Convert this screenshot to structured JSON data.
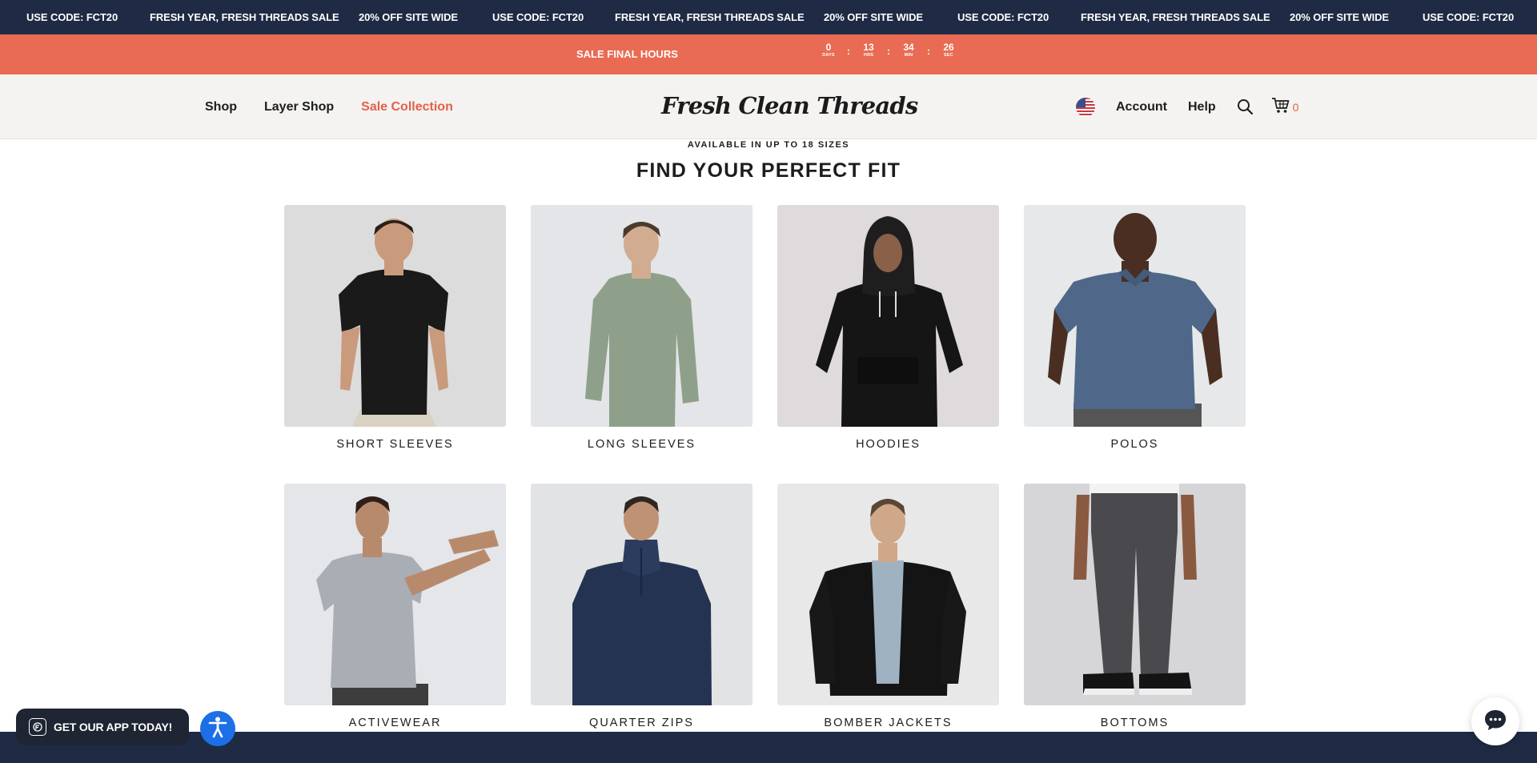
{
  "promo_marquee": {
    "items": [
      "USE CODE: FCT20",
      "FRESH YEAR, FRESH THREADS SALE",
      "20% OFF SITE WIDE",
      "USE CODE: FCT20",
      "FRESH YEAR, FRESH THREADS SALE",
      "20% OFF SITE WIDE",
      "USE CODE: FCT20",
      "FRESH YEAR, FRESH THREADS SALE",
      "20% OFF SITE WIDE",
      "USE CODE: FCT20"
    ]
  },
  "sale_bar": {
    "label": "SALE FINAL HOURS",
    "countdown": {
      "days": "0",
      "days_label": "DAYS",
      "hours": "13",
      "hours_label": "HRS",
      "minutes": "34",
      "minutes_label": "MIN",
      "seconds": "26",
      "seconds_label": "SEC",
      "separator": ":"
    },
    "background": "#e96b53"
  },
  "header": {
    "nav": {
      "shop": "Shop",
      "layer_shop": "Layer Shop",
      "sale_collection": "Sale Collection"
    },
    "logo": "Fresh Clean Threads",
    "account": "Account",
    "help": "Help",
    "cart_count": "0",
    "icons": {
      "flag": "us-flag-icon",
      "search": "search-icon",
      "cart": "cart-icon"
    }
  },
  "main": {
    "eyebrow": "AVAILABLE IN UP TO 18 SIZES",
    "title": "FIND YOUR PERFECT FIT",
    "categories": [
      {
        "label": "SHORT SLEEVES",
        "image": "man-black-tshirt"
      },
      {
        "label": "LONG SLEEVES",
        "image": "man-sage-long-sleeve"
      },
      {
        "label": "HOODIES",
        "image": "man-black-hoodie"
      },
      {
        "label": "POLOS",
        "image": "man-blue-polo"
      },
      {
        "label": "ACTIVEWEAR",
        "image": "man-grey-athletic-tee-stretching"
      },
      {
        "label": "QUARTER ZIPS",
        "image": "man-navy-quarter-zip"
      },
      {
        "label": "BOMBER JACKETS",
        "image": "man-black-bomber-jacket"
      },
      {
        "label": "BOTTOMS",
        "image": "grey-pants-and-sneakers"
      }
    ]
  },
  "floating": {
    "app_banner": "GET OUR APP TODAY!",
    "accessibility": "accessibility-icon",
    "chat": "chat-icon"
  },
  "colors": {
    "navy": "#1f2a44",
    "coral": "#e96b53",
    "sale_link": "#e3604a",
    "header_bg": "#f4f3f1",
    "accessibility_blue": "#1d6fe8"
  }
}
